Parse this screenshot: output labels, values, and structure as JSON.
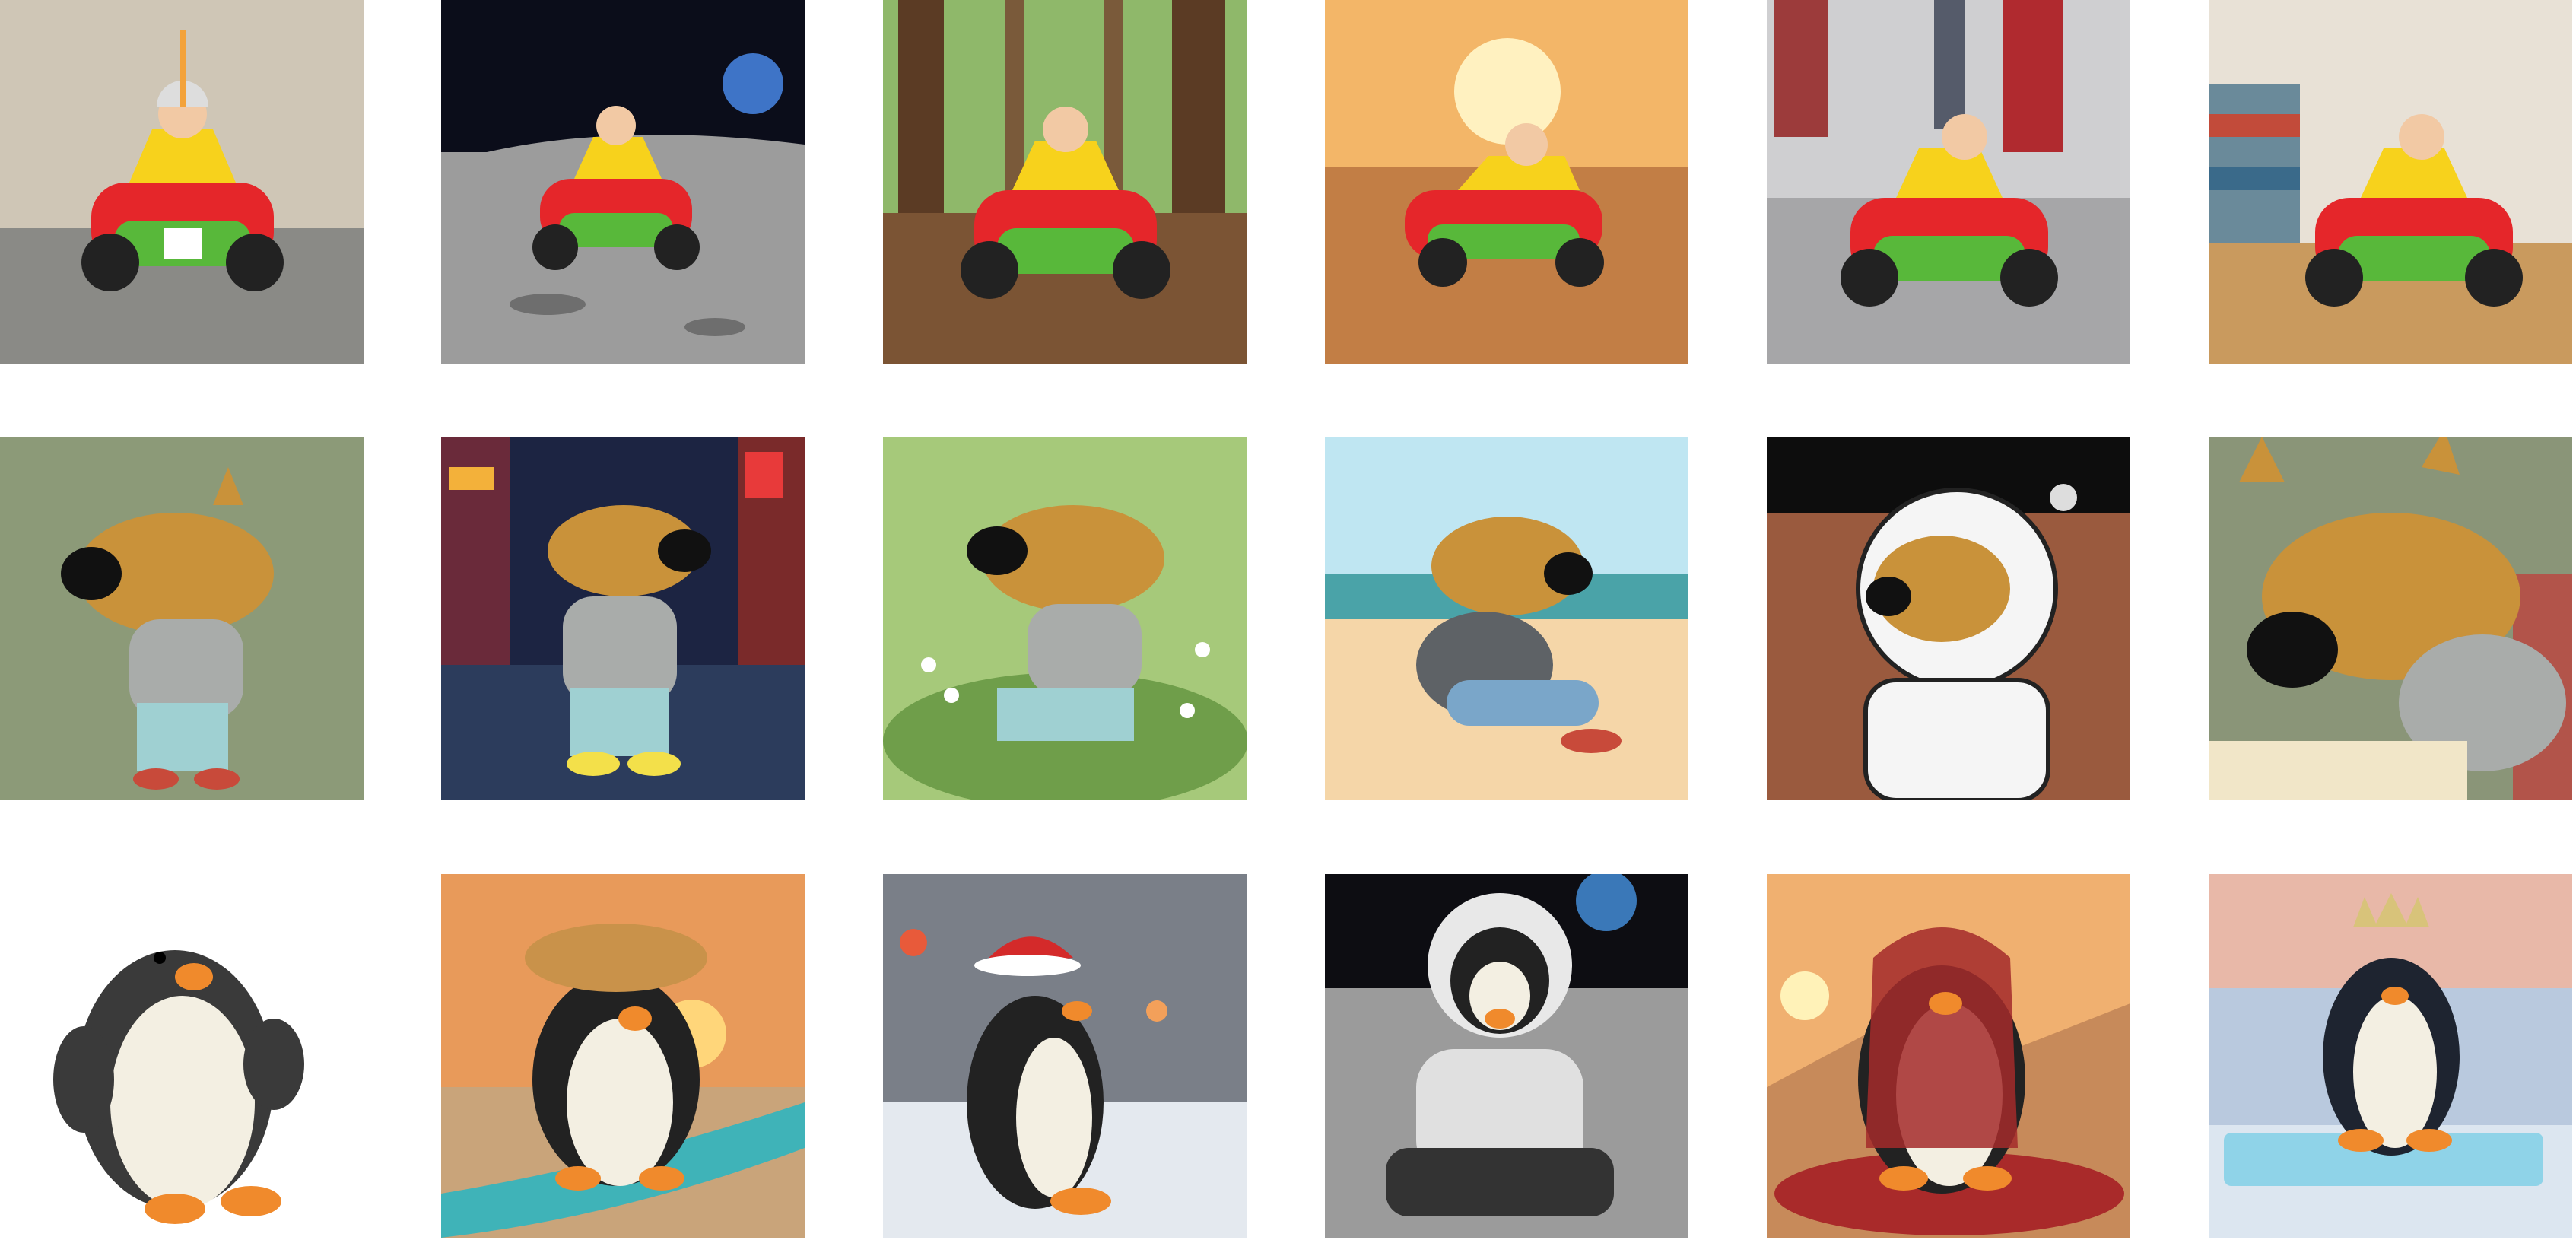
{
  "grid": {
    "rows": 3,
    "columns": 6,
    "background": "#ffffff",
    "row_subjects": [
      "toy-race-car",
      "cartoon-dog-character",
      "plush-penguin"
    ]
  },
  "tiles": [
    {
      "row": 0,
      "col": 0,
      "subject": "toy-race-car",
      "setting": "studio-on-carpet"
    },
    {
      "row": 0,
      "col": 1,
      "subject": "toy-race-car",
      "setting": "lunar-surface-with-earth"
    },
    {
      "row": 0,
      "col": 2,
      "subject": "toy-race-car",
      "setting": "redwood-forest"
    },
    {
      "row": 0,
      "col": 3,
      "subject": "toy-race-car",
      "setting": "desert-sunset"
    },
    {
      "row": 0,
      "col": 4,
      "subject": "toy-race-car",
      "setting": "city-sidewalk"
    },
    {
      "row": 0,
      "col": 5,
      "subject": "toy-race-car",
      "setting": "desk-with-books"
    },
    {
      "row": 1,
      "col": 0,
      "subject": "cartoon-dog-character",
      "setting": "plain-green-background"
    },
    {
      "row": 1,
      "col": 1,
      "subject": "cartoon-dog-character",
      "setting": "neon-city-street-night"
    },
    {
      "row": 1,
      "col": 2,
      "subject": "cartoon-dog-character",
      "setting": "meadow-with-flowers"
    },
    {
      "row": 1,
      "col": 3,
      "subject": "cartoon-dog-character",
      "setting": "beach-sitting"
    },
    {
      "row": 1,
      "col": 4,
      "subject": "cartoon-dog-character",
      "setting": "astronaut-on-mars"
    },
    {
      "row": 1,
      "col": 5,
      "subject": "cartoon-dog-character",
      "setting": "reading-book"
    },
    {
      "row": 2,
      "col": 0,
      "subject": "plush-penguin",
      "setting": "white-background"
    },
    {
      "row": 2,
      "col": 1,
      "subject": "plush-penguin",
      "setting": "surfboard-sunset-with-straw-hat"
    },
    {
      "row": 2,
      "col": 2,
      "subject": "plush-penguin",
      "setting": "snowy-street-santa-hat"
    },
    {
      "row": 2,
      "col": 3,
      "subject": "plush-penguin",
      "setting": "astronaut-on-moon"
    },
    {
      "row": 2,
      "col": 4,
      "subject": "plush-penguin",
      "setting": "desert-with-red-cloak"
    },
    {
      "row": 2,
      "col": 5,
      "subject": "plush-penguin",
      "setting": "ice-with-crown"
    }
  ],
  "colors": {
    "car_red": "#e5262a",
    "car_yellow": "#f7d21c",
    "car_green": "#58b83a",
    "dog_fur": "#c9923a",
    "dog_sweater": "#a9acaa",
    "dog_jeans": "#9fd0d2",
    "penguin_black": "#222222",
    "penguin_belly": "#f3efe2",
    "penguin_beak": "#f08a2c"
  }
}
